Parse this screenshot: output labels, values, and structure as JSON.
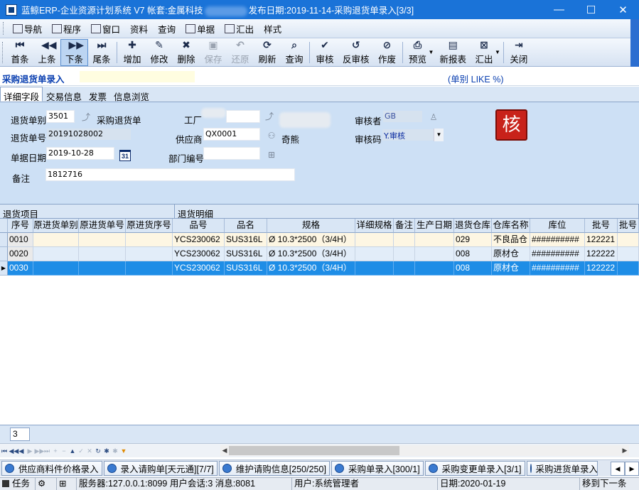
{
  "window": {
    "title_prefix": "蓝鲸ERP-企业资源计划系统 V7 帐套:金属科技",
    "title_suffix": "发布日期:2019-11-14-采购退货单录入[3/3]",
    "minimize": "—",
    "maximize": "☐",
    "close": "✕"
  },
  "menu": {
    "items": [
      {
        "label": "导航",
        "icon": "nav-icon"
      },
      {
        "label": "程序",
        "icon": "program-icon"
      },
      {
        "label": "窗口",
        "icon": "window-icon"
      },
      {
        "label": "资料",
        "icon": ""
      },
      {
        "label": "查询",
        "icon": ""
      },
      {
        "label": "单据",
        "icon": "document-icon"
      },
      {
        "label": "汇出",
        "icon": "export-icon"
      },
      {
        "label": "样式",
        "icon": ""
      }
    ]
  },
  "toolbar": {
    "first": "首条",
    "prev": "上条",
    "next": "下条",
    "last": "尾条",
    "add": "增加",
    "edit": "修改",
    "delete": "删除",
    "save": "保存",
    "restore": "还原",
    "refresh": "刷新",
    "query": "查询",
    "approve": "审核",
    "unapprove": "反审核",
    "void": "作废",
    "preview": "预览",
    "new_report": "新报表",
    "export": "汇出",
    "close": "关闭"
  },
  "header": {
    "form_title": "采购退货单录入",
    "filter": "(单别 LIKE %)"
  },
  "tabs": [
    "详细字段",
    "交易信息",
    "发票",
    "信息浏览"
  ],
  "form": {
    "doc_type_label": "退货单别",
    "doc_type_value": "3501",
    "doc_type_name": "采购退货单",
    "doc_no_label": "退货单号",
    "doc_no_value": "20191028002",
    "doc_date_label": "单据日期",
    "doc_date_value": "2019-10-28",
    "factory_label": "工厂",
    "supplier_label": "供应商",
    "supplier_value": "QX0001",
    "supplier_name": "奇熊",
    "dept_label": "部门编号",
    "dept_value": "",
    "reviewer_label": "审核者",
    "reviewer_value": "GB",
    "review_code_label": "审核码",
    "review_code_value": "Y.审核",
    "remark_label": "备注",
    "remark_value": "1812716",
    "approved_stamp": "核",
    "calendar_glyph": "31"
  },
  "grid": {
    "group_left": "退货项目",
    "group_right": "退货明细",
    "columns": [
      "序号",
      "原进货单别",
      "原进货单号",
      "原进货序号",
      "品号",
      "品名",
      "规格",
      "详细规格",
      "备注",
      "生产日期",
      "退货仓库",
      "仓库名称",
      "库位",
      "批号",
      "批号"
    ],
    "rows": [
      {
        "seq": "0010",
        "src_type": "",
        "src_no": "",
        "src_seq": "",
        "item_no": "YCS230062",
        "item_name": "SUS316L",
        "spec": "Ø 10.3*2500（3/4H）",
        "detail_spec": "",
        "remark": "",
        "prod_date": "",
        "warehouse": "029",
        "warehouse_name": "不良品仓",
        "location": "##########",
        "batch": "122221",
        "batch2": ""
      },
      {
        "seq": "0020",
        "src_type": "",
        "src_no": "",
        "src_seq": "",
        "item_no": "YCS230062",
        "item_name": "SUS316L",
        "spec": "Ø 10.3*2500（3/4H）",
        "detail_spec": "",
        "remark": "",
        "prod_date": "",
        "warehouse": "008",
        "warehouse_name": "原材仓",
        "location": "##########",
        "batch": "122222",
        "batch2": ""
      },
      {
        "seq": "0030",
        "src_type": "",
        "src_no": "",
        "src_seq": "",
        "item_no": "YCS230062",
        "item_name": "SUS316L",
        "spec": "Ø 10.3*2500（3/4H）",
        "detail_spec": "",
        "remark": "",
        "prod_date": "",
        "warehouse": "008",
        "warehouse_name": "原材仓",
        "location": "##########",
        "batch": "122222",
        "batch2": ""
      }
    ],
    "row_count": "3",
    "current_row_marker": "▶"
  },
  "navigator": [
    "⏮",
    "◀◀",
    "◀",
    "▶",
    "▶▶",
    "⏭",
    "+",
    "−",
    "▲",
    "✓",
    "✕",
    "↻",
    "✱",
    "✱",
    "▼"
  ],
  "task_tabs": [
    "供应商料件价格录入",
    "录入请购单[天元通][7/7]",
    "维护请购信息[250/250]",
    "采购单录入[300/1]",
    "采购变更单录入[3/1]",
    "采购进货单录入["
  ],
  "status": {
    "task": "任务",
    "server": "服务器:127.0.0.1:8099 用户会话:3 消息:8081",
    "user": "用户:系统管理者",
    "date": "日期:2020-01-19",
    "next_hint": "移到下一条"
  }
}
